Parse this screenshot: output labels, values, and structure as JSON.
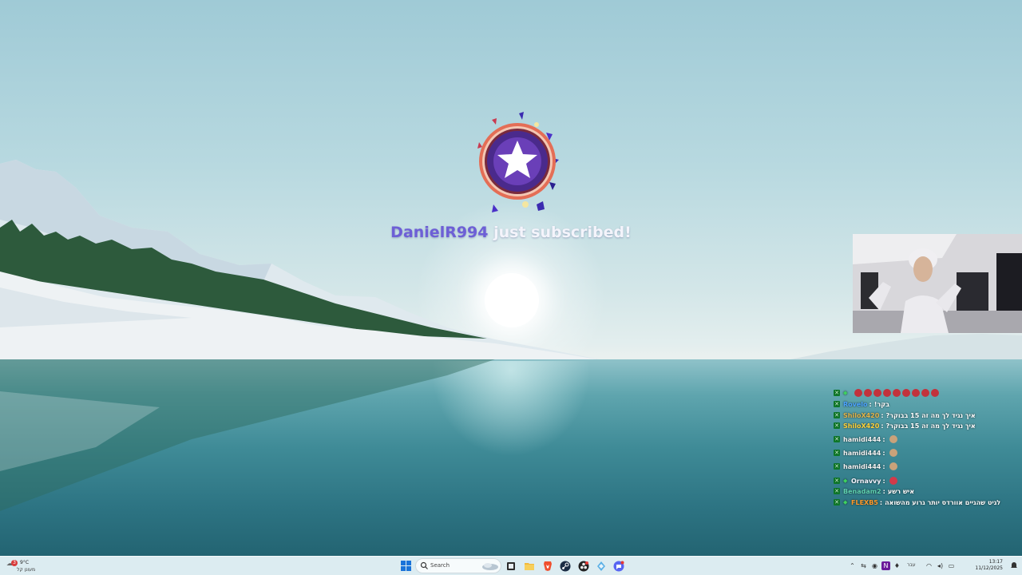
{
  "alert": {
    "username": "DanielR994",
    "message": " just subscribed!",
    "colors": {
      "username": "#6d5fd6",
      "message": "#f4f4fb",
      "badge_ring": "#e6725a",
      "badge_core": "#4a2a8c"
    },
    "icon": "star-badge-icon"
  },
  "webcam": {
    "icon": "webcam-feed"
  },
  "chat": {
    "messages": [
      {
        "badge": "moderator-icon",
        "subscriber": true,
        "user": "",
        "user_color": "#e0832a",
        "text": "",
        "emotes": 9,
        "emote_color": "#c2323c"
      },
      {
        "badge": "moderator-icon",
        "subscriber": false,
        "user": "Rovelo",
        "user_color": "#4aa3ff",
        "text": "בקר!",
        "emotes": 0
      },
      {
        "badge": "moderator-icon",
        "subscriber": false,
        "user": "ShiloX420",
        "user_color": "#e2b44a",
        "text": "איך נגיד לך מה זה 15 בבוקר?",
        "emotes": 0
      },
      {
        "badge": "moderator-icon",
        "subscriber": false,
        "user": "ShiloX420",
        "user_color": "#ffd23a",
        "text": "איך נגיד לך מה זה 15 בבוקר?",
        "emotes": 0
      },
      {
        "badge": "moderator-icon",
        "subscriber": false,
        "user": "hamidi444",
        "user_color": "#f2f2f2",
        "text": "",
        "emotes": 1,
        "emote_color": "#c9a27a"
      },
      {
        "badge": "moderator-icon",
        "subscriber": false,
        "user": "hamidi444",
        "user_color": "#f2f2f2",
        "text": "",
        "emotes": 1,
        "emote_color": "#c9a27a"
      },
      {
        "badge": "moderator-icon",
        "subscriber": false,
        "user": "hamidi444",
        "user_color": "#f2f2f2",
        "text": "",
        "emotes": 1,
        "emote_color": "#c9a27a"
      },
      {
        "badge": "moderator-icon",
        "subscriber": true,
        "user": "Ornavvy",
        "user_color": "#f5f5ff",
        "text": "",
        "emotes": 1,
        "emote_color": "#d23a4a"
      },
      {
        "badge": "moderator-icon",
        "subscriber": false,
        "user": "Benadam2",
        "user_color": "#5fd1b0",
        "text": "איש רשע",
        "emotes": 0
      },
      {
        "badge": "moderator-icon",
        "subscriber": true,
        "user": "FLEXB5",
        "user_color": "#ff9a2a",
        "text": "לגיט שהגיים אוורדס יותר גרוע מהשואה",
        "emotes": 0
      }
    ]
  },
  "taskbar": {
    "weather": {
      "icon": "weather-icon",
      "count": "3",
      "temp": "9°C",
      "desc": "מעונן קל"
    },
    "start_icon": "windows-start-icon",
    "search": {
      "placeholder": "Search",
      "icon": "search-icon"
    },
    "apps": [
      {
        "name": "task-view-icon"
      },
      {
        "name": "file-explorer-icon"
      },
      {
        "name": "brave-browser-icon"
      },
      {
        "name": "steam-icon"
      },
      {
        "name": "obs-icon"
      },
      {
        "name": "app-diamond-icon"
      },
      {
        "name": "chat-app-icon"
      }
    ],
    "tray": {
      "language": "עבר",
      "time": "13:17",
      "date": "11/12/2025"
    }
  }
}
